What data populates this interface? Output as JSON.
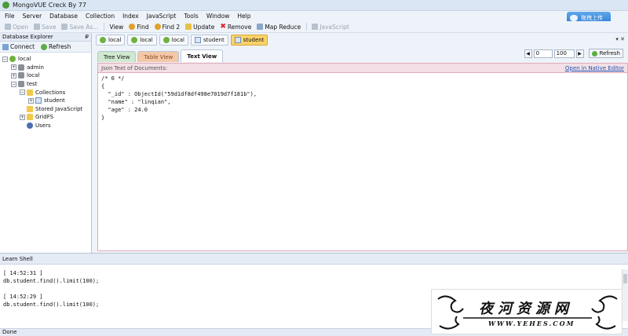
{
  "window": {
    "title": "MongoVUE Creck By 77"
  },
  "menu": [
    "File",
    "Server",
    "Database",
    "Collection",
    "Index",
    "JavaScript",
    "Tools",
    "Window",
    "Help"
  ],
  "upload_button": {
    "label": "拖拽上传"
  },
  "toolbar": {
    "open": "Open",
    "save": "Save",
    "save_as": "Save As...",
    "view": "View",
    "find": "Find",
    "find2": "Find 2",
    "update": "Update",
    "remove": "Remove",
    "map_reduce": "Map Reduce",
    "javascript": "JavaScript"
  },
  "explorer": {
    "title": "Database Explorer",
    "pin": "₽",
    "connect": "Connect",
    "refresh": "Refresh",
    "tree": {
      "root": "local",
      "admin": "admin",
      "local": "local",
      "test": "test",
      "collections": "Collections",
      "student": "student",
      "stored_js": "Stored JavaScript",
      "gridfs": "GridFS",
      "users": "Users"
    }
  },
  "doc_tabs": [
    "local",
    "local",
    "local",
    "student",
    "student"
  ],
  "win_ctrl": "▾ ✕",
  "view_tabs": {
    "tree": "Tree View",
    "table": "Table View",
    "text": "Text View"
  },
  "pager": {
    "skip": "0",
    "limit": "100",
    "refresh": "Refresh"
  },
  "content": {
    "header": "Json Text of Documents:",
    "native_editor": "Open in Native Editor",
    "json": "/* 0 */\n{\n  \"_id\" : ObjectId(\"59d1df8df498e7019d7f181b\"),\n  \"name\" : \"linqian\",\n  \"age\" : 24.0\n}"
  },
  "shell": {
    "title": "Learn Shell",
    "log": "[ 14:52:31 ]\ndb.student.find().limit(100);\n\n[ 14:52:29 ]\ndb.student.find().limit(100);"
  },
  "status": "Done",
  "watermark": {
    "title": "夜河资源网",
    "url": "WWW.YEHES.COM"
  }
}
